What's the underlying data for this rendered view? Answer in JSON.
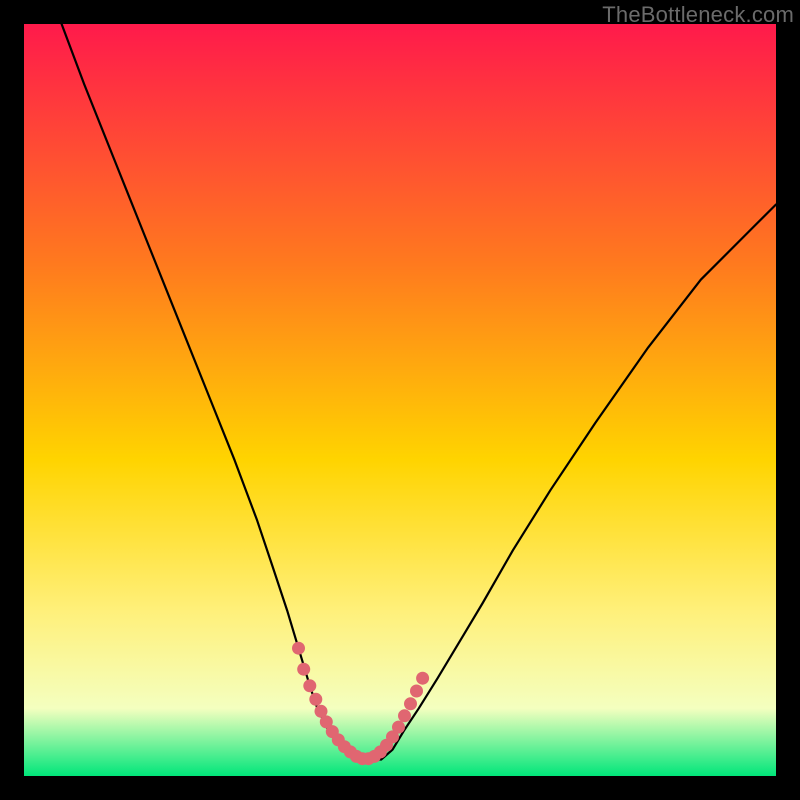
{
  "watermark": "TheBottleneck.com",
  "colors": {
    "gradient_top": "#ff1a4b",
    "gradient_mid1": "#ff7a1e",
    "gradient_mid2": "#ffd400",
    "gradient_mid3": "#fff07a",
    "gradient_mid4": "#f4ffbf",
    "gradient_bottom": "#00e67a",
    "curve": "#000000",
    "marker": "#e06671",
    "frame_bg": "#000000"
  },
  "chart_data": {
    "type": "line",
    "title": "",
    "xlabel": "",
    "ylabel": "",
    "xlim": [
      0,
      100
    ],
    "ylim": [
      0,
      100
    ],
    "grid": false,
    "legend": false,
    "annotations": [],
    "series": [
      {
        "name": "curve",
        "x": [
          5,
          8,
          12,
          16,
          20,
          24,
          28,
          31,
          33,
          35,
          36.5,
          38,
          39,
          40.5,
          42.5,
          45,
          47.5,
          49,
          50.5,
          52.5,
          55,
          58,
          61,
          65,
          70,
          76,
          83,
          90,
          97,
          100
        ],
        "y": [
          100,
          92,
          82,
          72,
          62,
          52,
          42,
          34,
          28,
          22,
          17,
          12,
          9,
          6,
          3.5,
          2.2,
          2.2,
          3.5,
          6,
          9,
          13,
          18,
          23,
          30,
          38,
          47,
          57,
          66,
          73,
          76
        ]
      },
      {
        "name": "marker",
        "x": [
          36.5,
          37.2,
          38,
          38.8,
          39.5,
          40.2,
          41,
          41.8,
          42.6,
          43.4,
          44.2,
          45,
          45.8,
          46.6,
          47.4,
          48.2,
          49,
          49.8,
          50.6,
          51.4,
          52.2,
          53
        ],
        "y": [
          17,
          14.2,
          12,
          10.2,
          8.6,
          7.2,
          5.9,
          4.8,
          3.9,
          3.2,
          2.6,
          2.3,
          2.3,
          2.6,
          3.2,
          4.1,
          5.2,
          6.5,
          8,
          9.6,
          11.3,
          13
        ]
      }
    ]
  }
}
